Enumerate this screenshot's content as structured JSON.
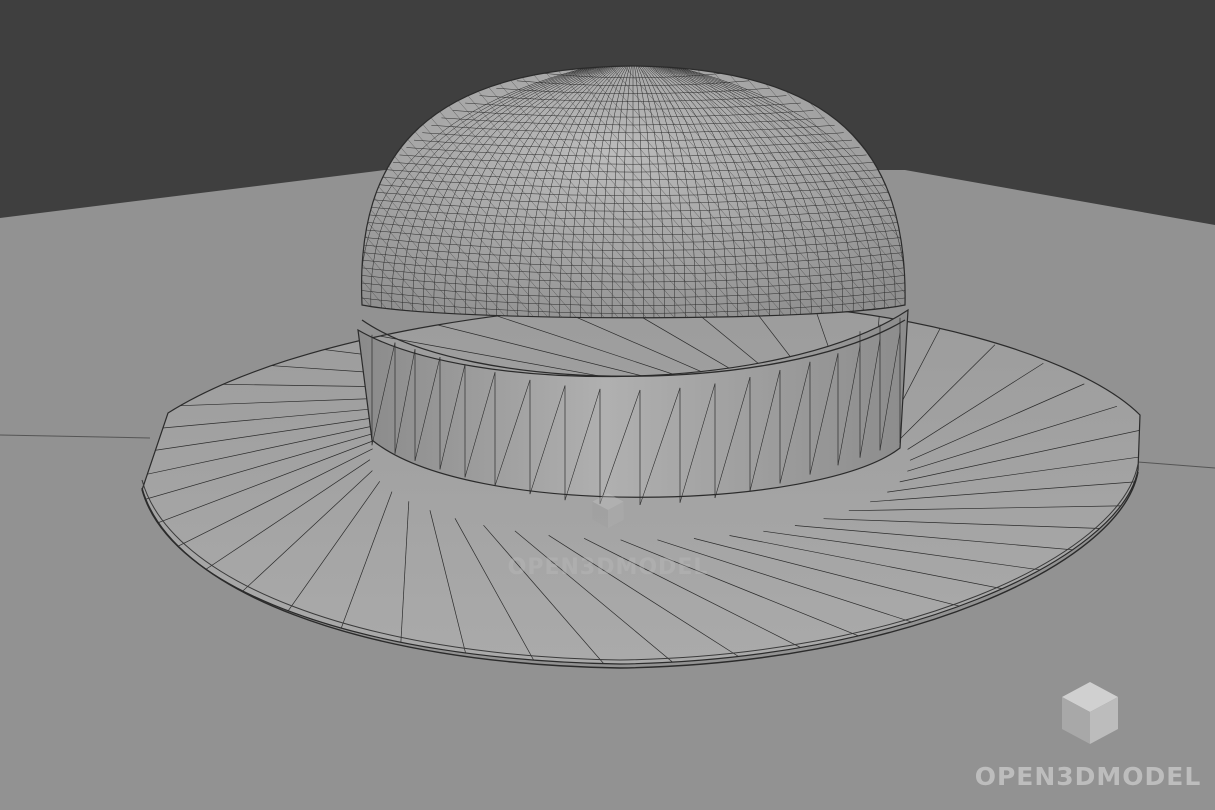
{
  "scene": {
    "subject": "hat-wireframe-model",
    "colors": {
      "background": "#3f3f3f",
      "ground": "#929292",
      "surface": "#a4a4a4",
      "wire": "#2b2b2b",
      "watermark": "#bdbdbd"
    }
  },
  "watermarks": {
    "center_text": "OPEN3DMODEL",
    "corner_text": "OPEN3DMODEL",
    "logo_icon": "cube-logo-icon"
  }
}
